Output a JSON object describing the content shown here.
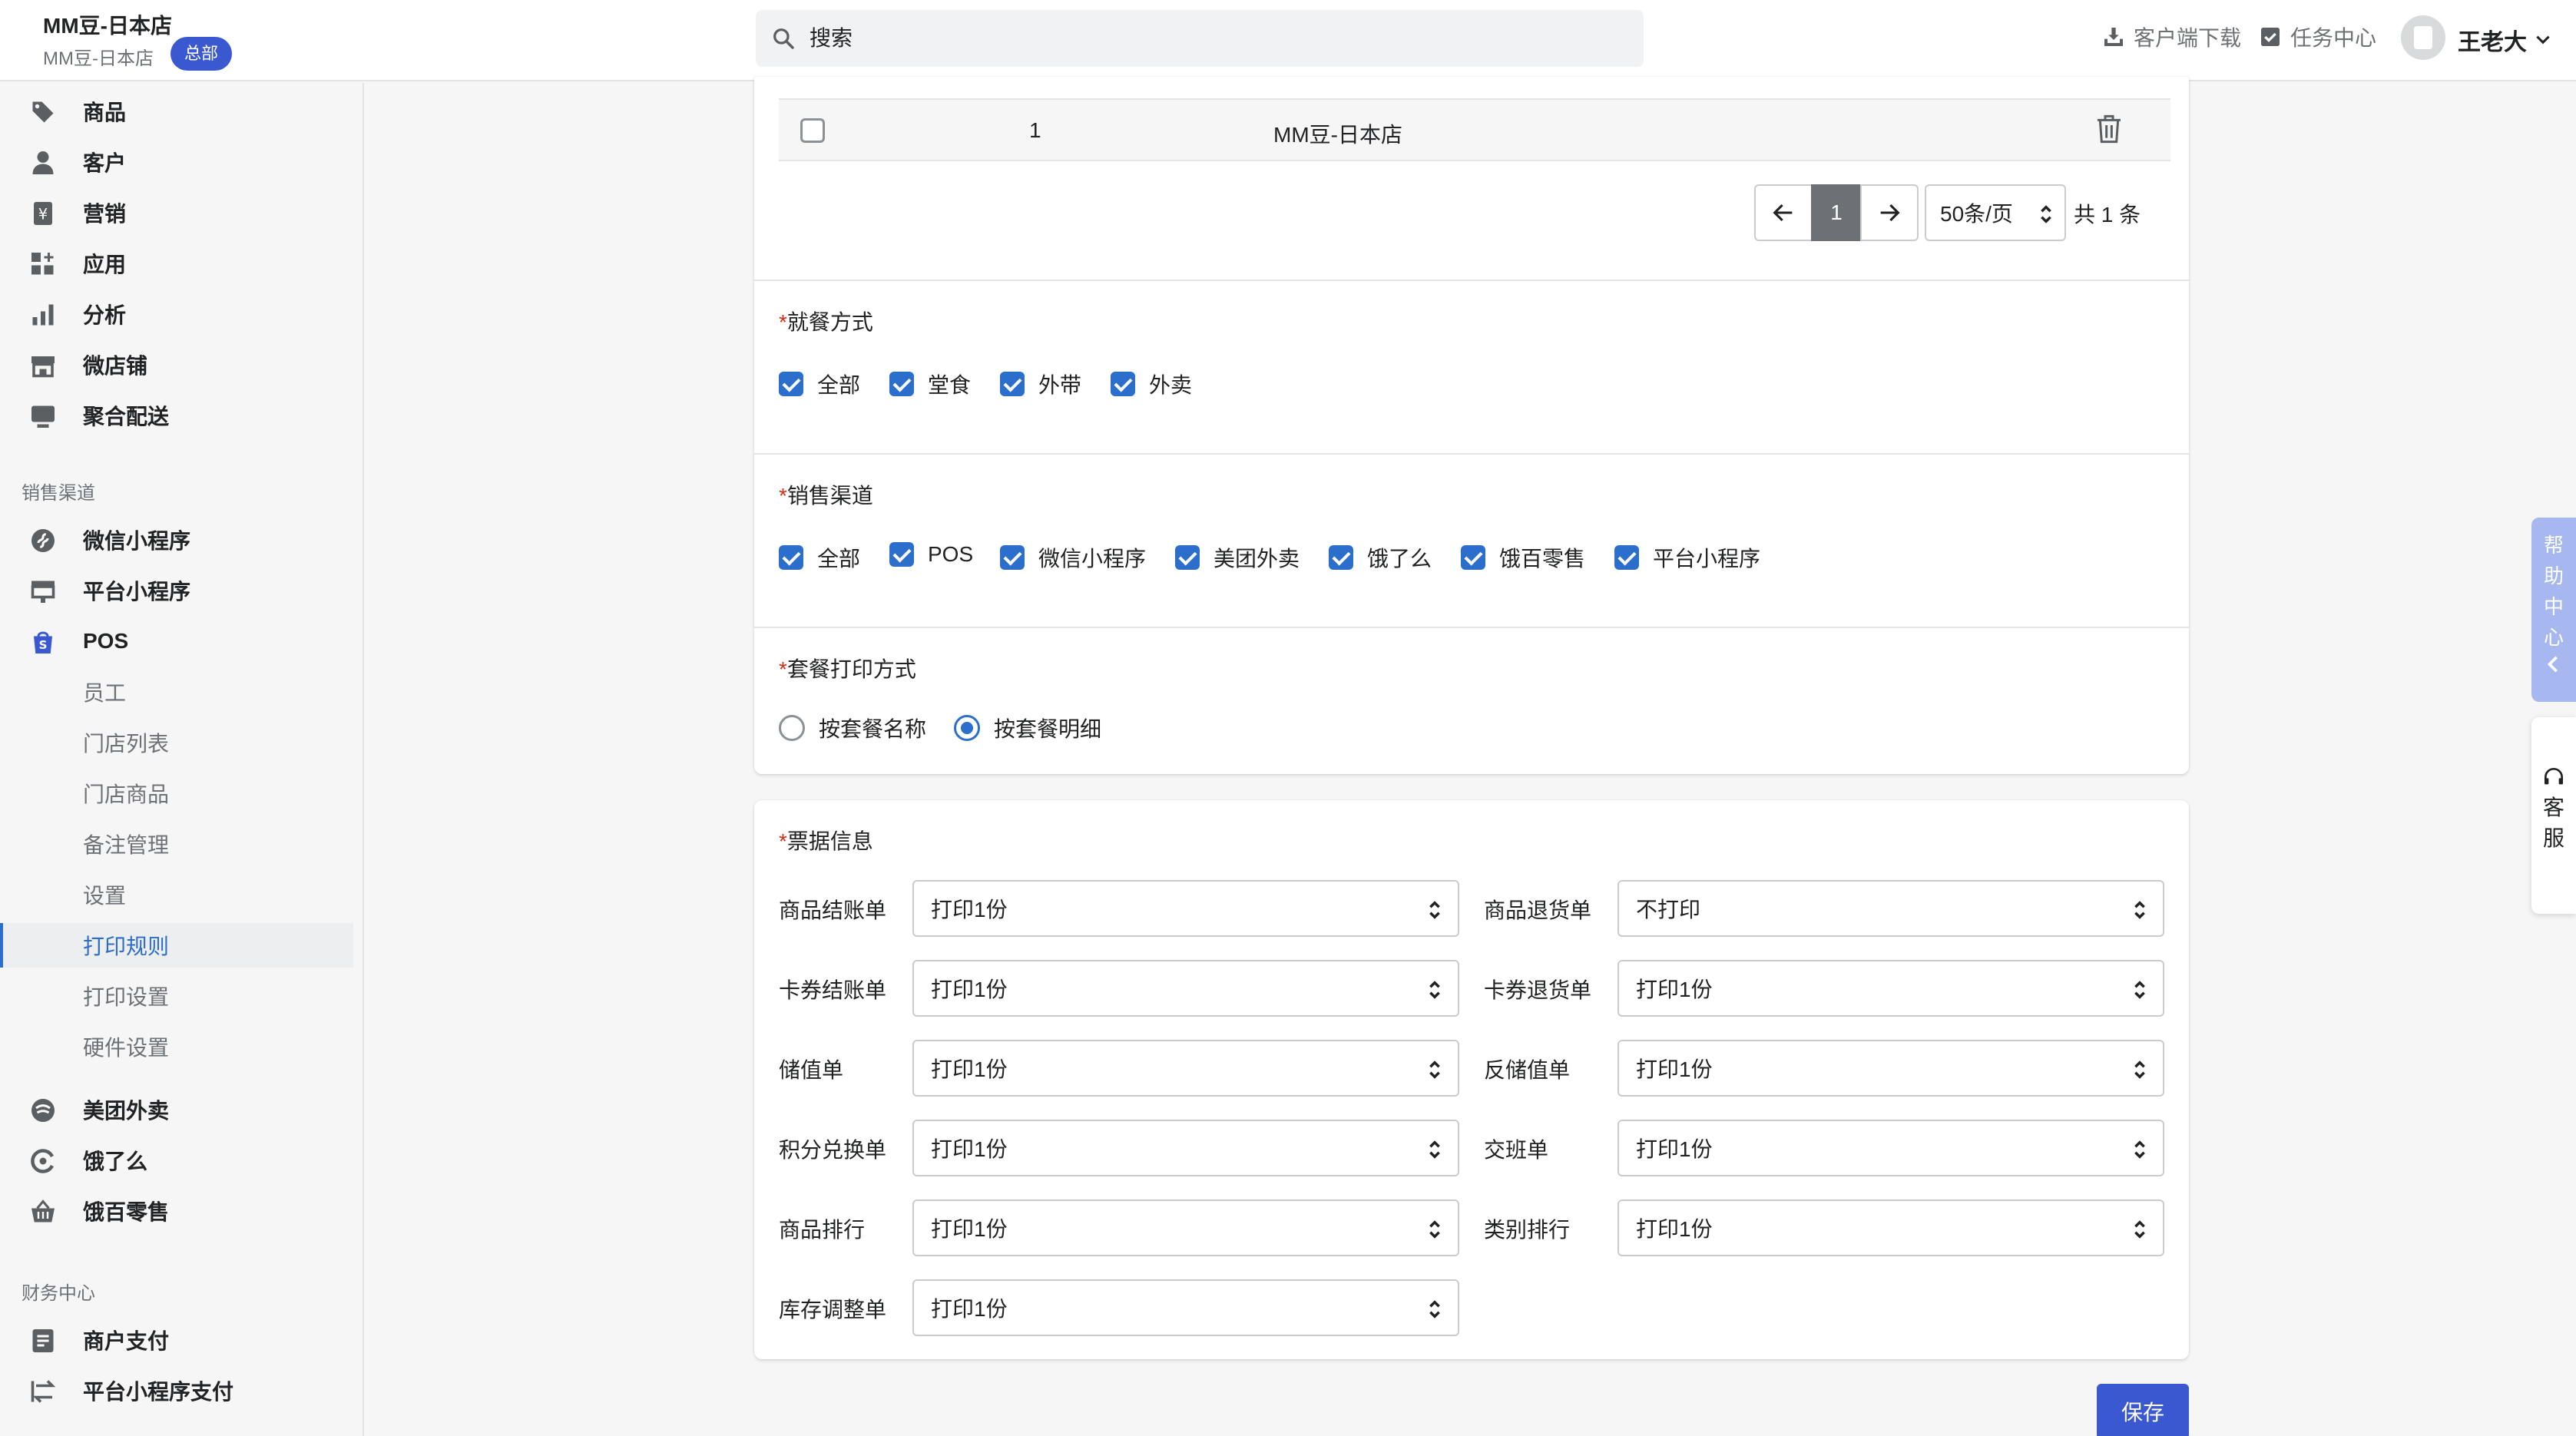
{
  "header": {
    "shop_name": "MM豆-日本店",
    "shop_sub": "MM豆-日本店",
    "badge": "总部",
    "search_placeholder": "搜索",
    "download": "客户端下载",
    "tasks": "任务中心",
    "user": "王老大"
  },
  "sidebar": {
    "main_items": [
      {
        "label": "商品",
        "icon": "tag-icon"
      },
      {
        "label": "客户",
        "icon": "person-icon"
      },
      {
        "label": "营销",
        "icon": "yen-icon"
      },
      {
        "label": "应用",
        "icon": "apps-icon"
      },
      {
        "label": "分析",
        "icon": "bar-chart-icon"
      },
      {
        "label": "微店铺",
        "icon": "store-icon"
      },
      {
        "label": "聚合配送",
        "icon": "delivery-icon"
      }
    ],
    "sales_title": "销售渠道",
    "sales_items": [
      {
        "label": "微信小程序",
        "icon": "mini-program-icon"
      },
      {
        "label": "平台小程序",
        "icon": "platform-icon"
      },
      {
        "label": "POS",
        "icon": "shopping-bag-icon"
      }
    ],
    "pos_sub": [
      "员工",
      "门店列表",
      "门店商品",
      "备注管理",
      "设置",
      "打印规则",
      "打印设置",
      "硬件设置"
    ],
    "active_sub": "打印规则",
    "delivery_items": [
      {
        "label": "美团外卖",
        "icon": "meituan-icon"
      },
      {
        "label": "饿了么",
        "icon": "eleme-icon"
      },
      {
        "label": "饿百零售",
        "icon": "basket-icon"
      }
    ],
    "finance_title": "财务中心",
    "finance_items": [
      {
        "label": "商户支付",
        "icon": "document-icon"
      },
      {
        "label": "平台小程序支付",
        "icon": "transfer-icon"
      }
    ]
  },
  "store_table": {
    "row": {
      "index": "1",
      "name": "MM豆-日本店"
    },
    "page": "1",
    "per_page": "50条/页",
    "total": "共 1 条"
  },
  "dining": {
    "label": "就餐方式",
    "options": [
      {
        "label": "全部",
        "checked": true
      },
      {
        "label": "堂食",
        "checked": true
      },
      {
        "label": "外带",
        "checked": true
      },
      {
        "label": "外卖",
        "checked": true
      }
    ]
  },
  "channels": {
    "label": "销售渠道",
    "options": [
      {
        "label": "全部",
        "checked": true
      },
      {
        "label": "POS",
        "checked": true
      },
      {
        "label": "微信小程序",
        "checked": true
      },
      {
        "label": "美团外卖",
        "checked": true
      },
      {
        "label": "饿了么",
        "checked": true
      },
      {
        "label": "饿百零售",
        "checked": true
      },
      {
        "label": "平台小程序",
        "checked": true
      }
    ]
  },
  "package_print": {
    "label": "套餐打印方式",
    "options": [
      {
        "label": "按套餐名称",
        "selected": false
      },
      {
        "label": "按套餐明细",
        "selected": true
      }
    ]
  },
  "receipts": {
    "label": "票据信息",
    "left": [
      {
        "label": "商品结账单",
        "value": "打印1份"
      },
      {
        "label": "卡券结账单",
        "value": "打印1份"
      },
      {
        "label": "储值单",
        "value": "打印1份"
      },
      {
        "label": "积分兑换单",
        "value": "打印1份"
      },
      {
        "label": "商品排行",
        "value": "打印1份"
      },
      {
        "label": "库存调整单",
        "value": "打印1份"
      }
    ],
    "right": [
      {
        "label": "商品退货单",
        "value": "不打印"
      },
      {
        "label": "卡券退货单",
        "value": "打印1份"
      },
      {
        "label": "反储值单",
        "value": "打印1份"
      },
      {
        "label": "交班单",
        "value": "打印1份"
      },
      {
        "label": "类别排行",
        "value": "打印1份"
      }
    ]
  },
  "save_label": "保存",
  "help_chars": [
    "帮",
    "助",
    "中",
    "心"
  ],
  "service_chars": [
    "客",
    "服"
  ],
  "colors": {
    "accent": "#2c6ecb",
    "brand": "#3a59d1",
    "required": "#d72c0d"
  }
}
